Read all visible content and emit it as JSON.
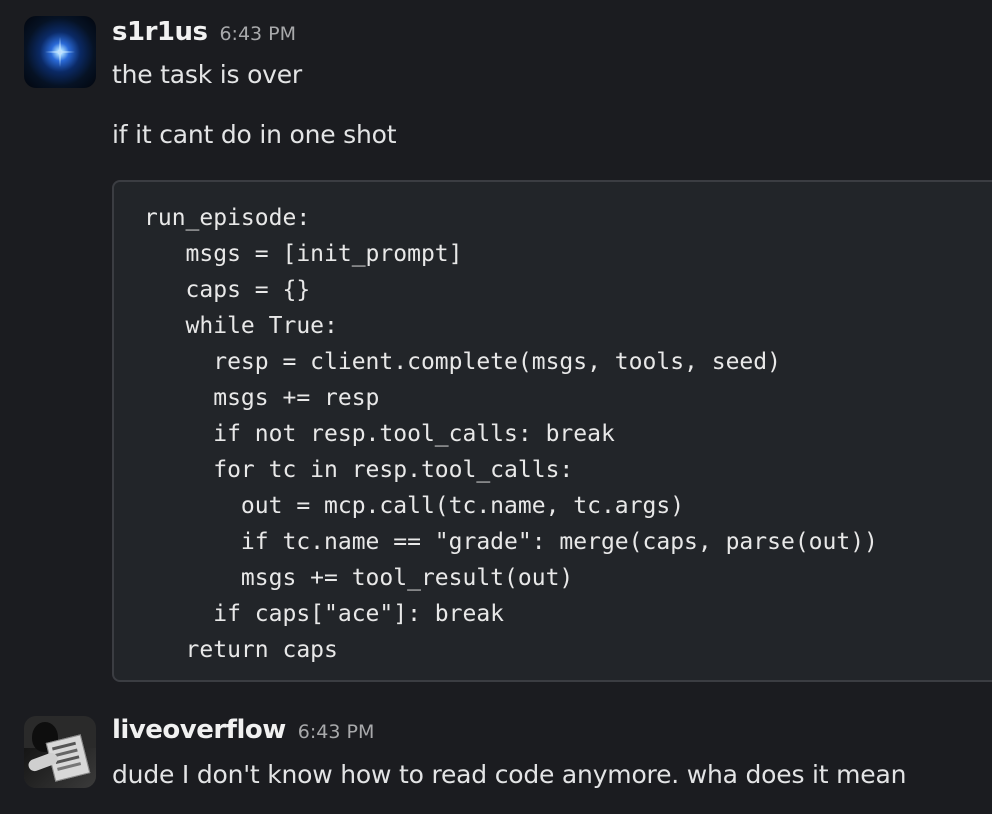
{
  "messages": [
    {
      "user": "s1r1us",
      "time": "6:43 PM",
      "avatar": "star-avatar",
      "lines": [
        "the task is over",
        "if it cant do in one shot"
      ],
      "code": "run_episode:\n   msgs = [init_prompt]\n   caps = {}\n   while True:\n     resp = client.complete(msgs, tools, seed)\n     msgs += resp\n     if not resp.tool_calls: break\n     for tc in resp.tool_calls:\n       out = mcp.call(tc.name, tc.args)\n       if tc.name == \"grade\": merge(caps, parse(out))\n       msgs += tool_result(out)\n     if caps[\"ace\"]: break\n   return caps"
    },
    {
      "user": "liveoverflow",
      "time": "6:43 PM",
      "avatar": "photo-avatar",
      "lines": [
        "dude I don't know how to read code anymore. wha does it mean"
      ]
    }
  ],
  "colors": {
    "background": "#1b1c20",
    "code_background": "#222529",
    "code_border": "#3b3d42",
    "username": "#f1f1f1",
    "timestamp": "#a8a9ab",
    "text": "#e3e4e5"
  }
}
